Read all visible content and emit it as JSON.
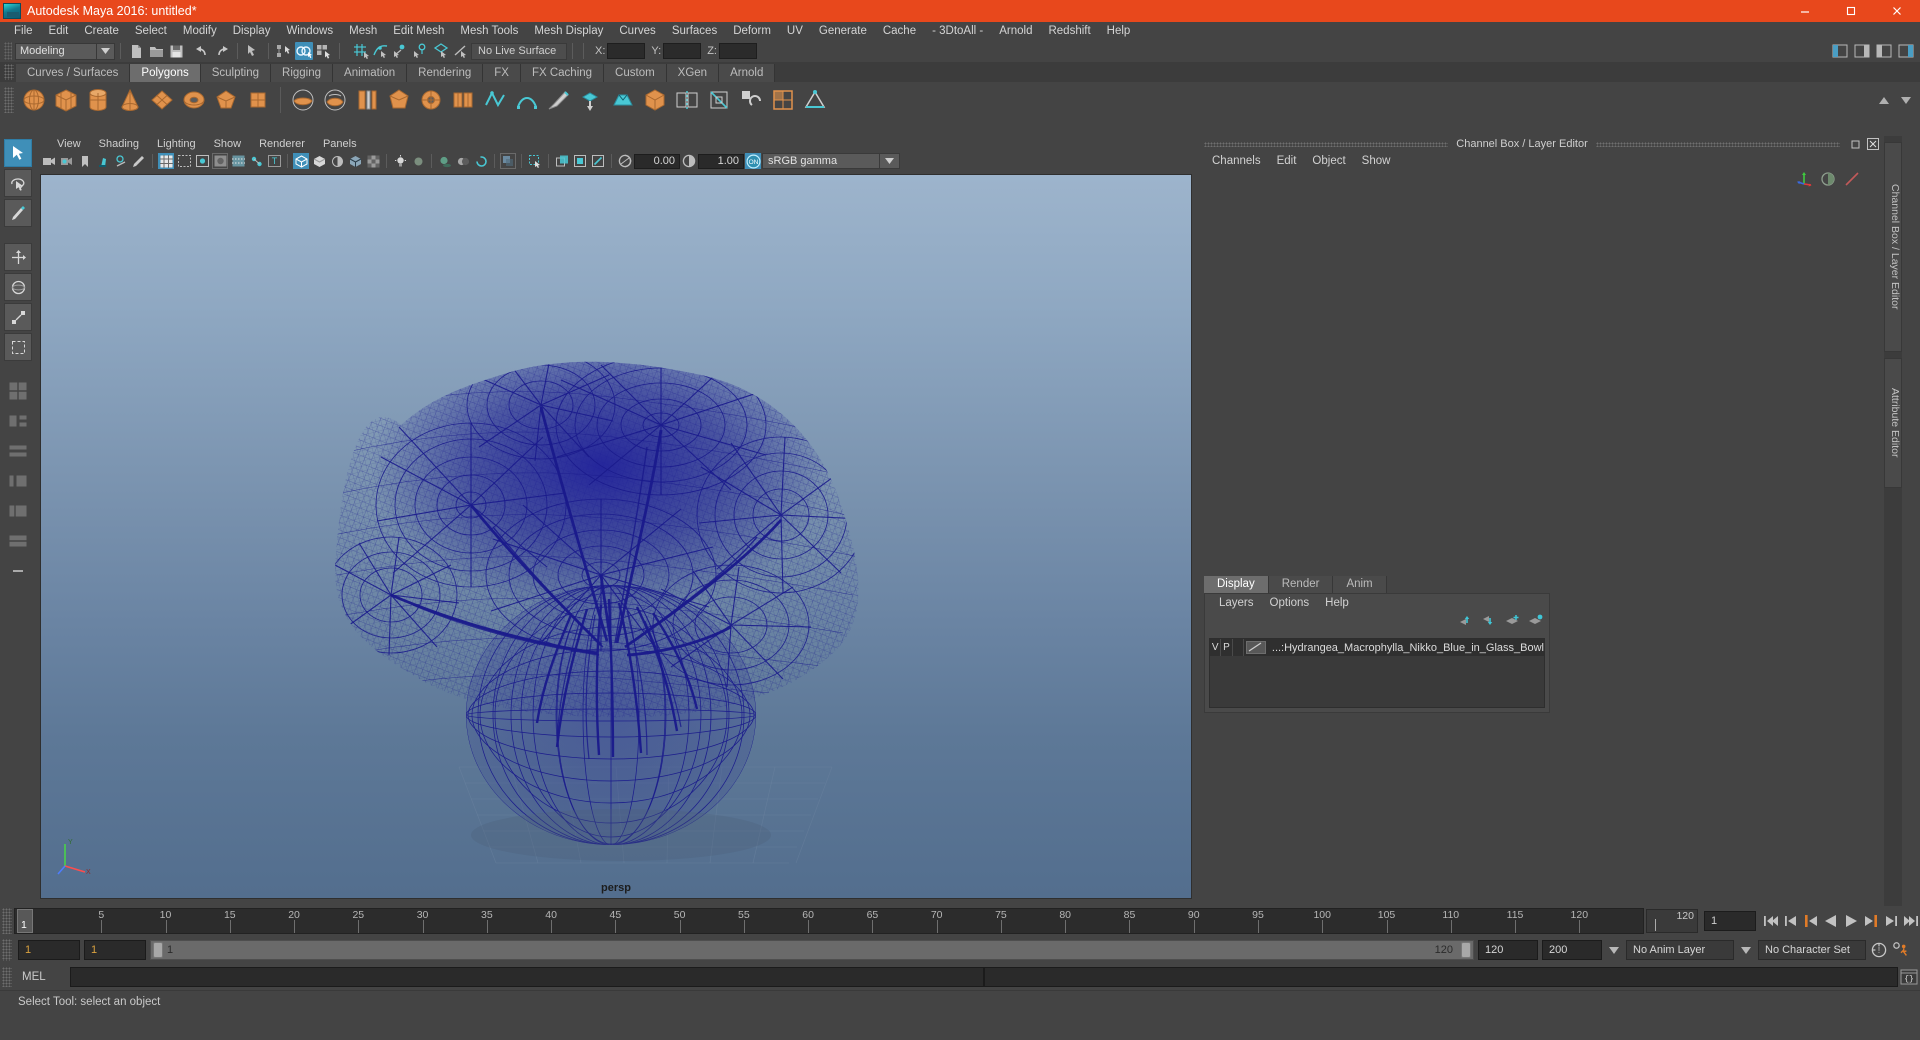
{
  "window": {
    "title": "Autodesk Maya 2016: untitled*",
    "logo_name": "maya-logo",
    "minimize_label": "–",
    "maximize_label": "☐",
    "close_label": "✕"
  },
  "menubar": {
    "items": [
      "File",
      "Edit",
      "Create",
      "Select",
      "Modify",
      "Display",
      "Windows",
      "Mesh",
      "Edit Mesh",
      "Mesh Tools",
      "Mesh Display",
      "Curves",
      "Surfaces",
      "Deform",
      "UV",
      "Generate",
      "Cache",
      "- 3DtoAll -",
      "Arnold",
      "Redshift",
      "Help"
    ]
  },
  "statusbar": {
    "menu_set": "Modeling",
    "live_surface": "No Live Surface",
    "coord_labels": [
      "X:",
      "Y:",
      "Z:"
    ],
    "coord_values": [
      "",
      "",
      ""
    ]
  },
  "shelf": {
    "tabs": [
      "Curves / Surfaces",
      "Polygons",
      "Sculpting",
      "Rigging",
      "Animation",
      "Rendering",
      "FX",
      "FX Caching",
      "Custom",
      "XGen",
      "Arnold"
    ],
    "active_tab": "Polygons"
  },
  "viewport_panel": {
    "menus": [
      "View",
      "Shading",
      "Lighting",
      "Show",
      "Renderer",
      "Panels"
    ],
    "exposure_value": "0.00",
    "gamma_value": "1.00",
    "color_management": "sRGB gamma",
    "camera_label": "persp",
    "axis_labels": [
      "Y",
      "X",
      "Z"
    ]
  },
  "channel_box": {
    "panel_title": "Channel Box / Layer Editor",
    "menus": [
      "Channels",
      "Edit",
      "Object",
      "Show"
    ]
  },
  "layer_editor": {
    "tabs": [
      "Display",
      "Render",
      "Anim"
    ],
    "active_tab": "Display",
    "menus": [
      "Layers",
      "Options",
      "Help"
    ],
    "rows": [
      {
        "visibility": "V",
        "playback": "P",
        "name": "...:Hydrangea_Macrophylla_Nikko_Blue_in_Glass_Bowl"
      }
    ]
  },
  "vertical_tabs": [
    "Channel Box / Layer Editor",
    "Attribute Editor"
  ],
  "timeline": {
    "ticks": [
      5,
      10,
      15,
      20,
      25,
      30,
      35,
      40,
      45,
      50,
      55,
      60,
      65,
      70,
      75,
      80,
      85,
      90,
      95,
      100,
      105,
      110,
      115,
      120
    ],
    "current_frame_marker": "1",
    "range_end_display": "120",
    "current_frame_field": "1",
    "playback_buttons": [
      "go-to-start",
      "step-back-keyframe",
      "step-back-frame",
      "play-backwards",
      "play-forwards",
      "step-forward-frame",
      "step-forward-keyframe",
      "go-to-end"
    ]
  },
  "range_slider": {
    "anim_start": "1",
    "range_start": "1",
    "slider_start_label": "1",
    "slider_end_label": "120",
    "range_end": "120",
    "anim_end": "200",
    "anim_layer": "No Anim Layer",
    "character_set": "No Character Set"
  },
  "command_line": {
    "label": "MEL",
    "input_value": "",
    "result_value": ""
  },
  "status_message": "Select Tool: select an object",
  "colors": {
    "title_bar": "#e8481c",
    "chrome": "#444444",
    "accent_blue": "#3f8fb8",
    "shelf_orange": "#e0924c",
    "wireframe_blue": "#1a1a8c",
    "viewport_top": "#9db4cc",
    "viewport_bottom": "#536e8e"
  }
}
